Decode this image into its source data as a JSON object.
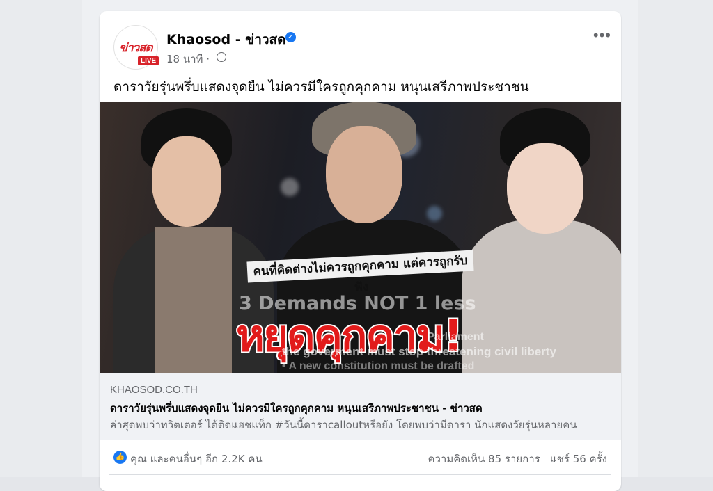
{
  "post": {
    "page_name": "Khaosod - ข่าวสด",
    "avatar_logo": "ข่าวสด",
    "avatar_badge": "LIVE",
    "time": "18 นาที",
    "meta_separator": "·",
    "more_label": "•••",
    "text": "ดาราวัยรุ่นพรึ่บแสดงจุดยืน ไม่ควรมีใครถูกคุกคาม หนุนเสรีภาพประชาชน"
  },
  "image": {
    "banner_small": "คนที่คิดต่างไม่ควรถูกคุกคาม แต่ควรถูกรับฟัง",
    "demands_text": "3 Demands NOT 1 less",
    "title": "หยุดคุกคาม!",
    "line1": "Parliament",
    "line2": "the goverment must stop threatening civil liberty",
    "line3": "• A new constitution must be drafted"
  },
  "link": {
    "domain": "KHAOSOD.CO.TH",
    "title": "ดาราวัยรุ่นพรึ่บแสดงจุดยืน ไม่ควรมีใครถูกคุกคาม หนุนเสรีภาพประชาชน - ข่าวสด",
    "description": "ล่าสุดพบว่าทวิตเตอร์ ได้ติดแฮชแท็ก #วันนี้ดาราcalloutหรือยัง โดยพบว่ามีดารา นักแสดงวัยรุ่นหลายคน"
  },
  "footer": {
    "reactions": "คุณ และคนอื่นๆ อีก 2.2K คน",
    "comments": "ความคิดเห็น 85 รายการ",
    "shares": "แชร์ 56 ครั้ง"
  },
  "colors": {
    "brand": "#d8232a",
    "facebook_blue": "#1877f2",
    "title_red": "#e21b1b"
  }
}
